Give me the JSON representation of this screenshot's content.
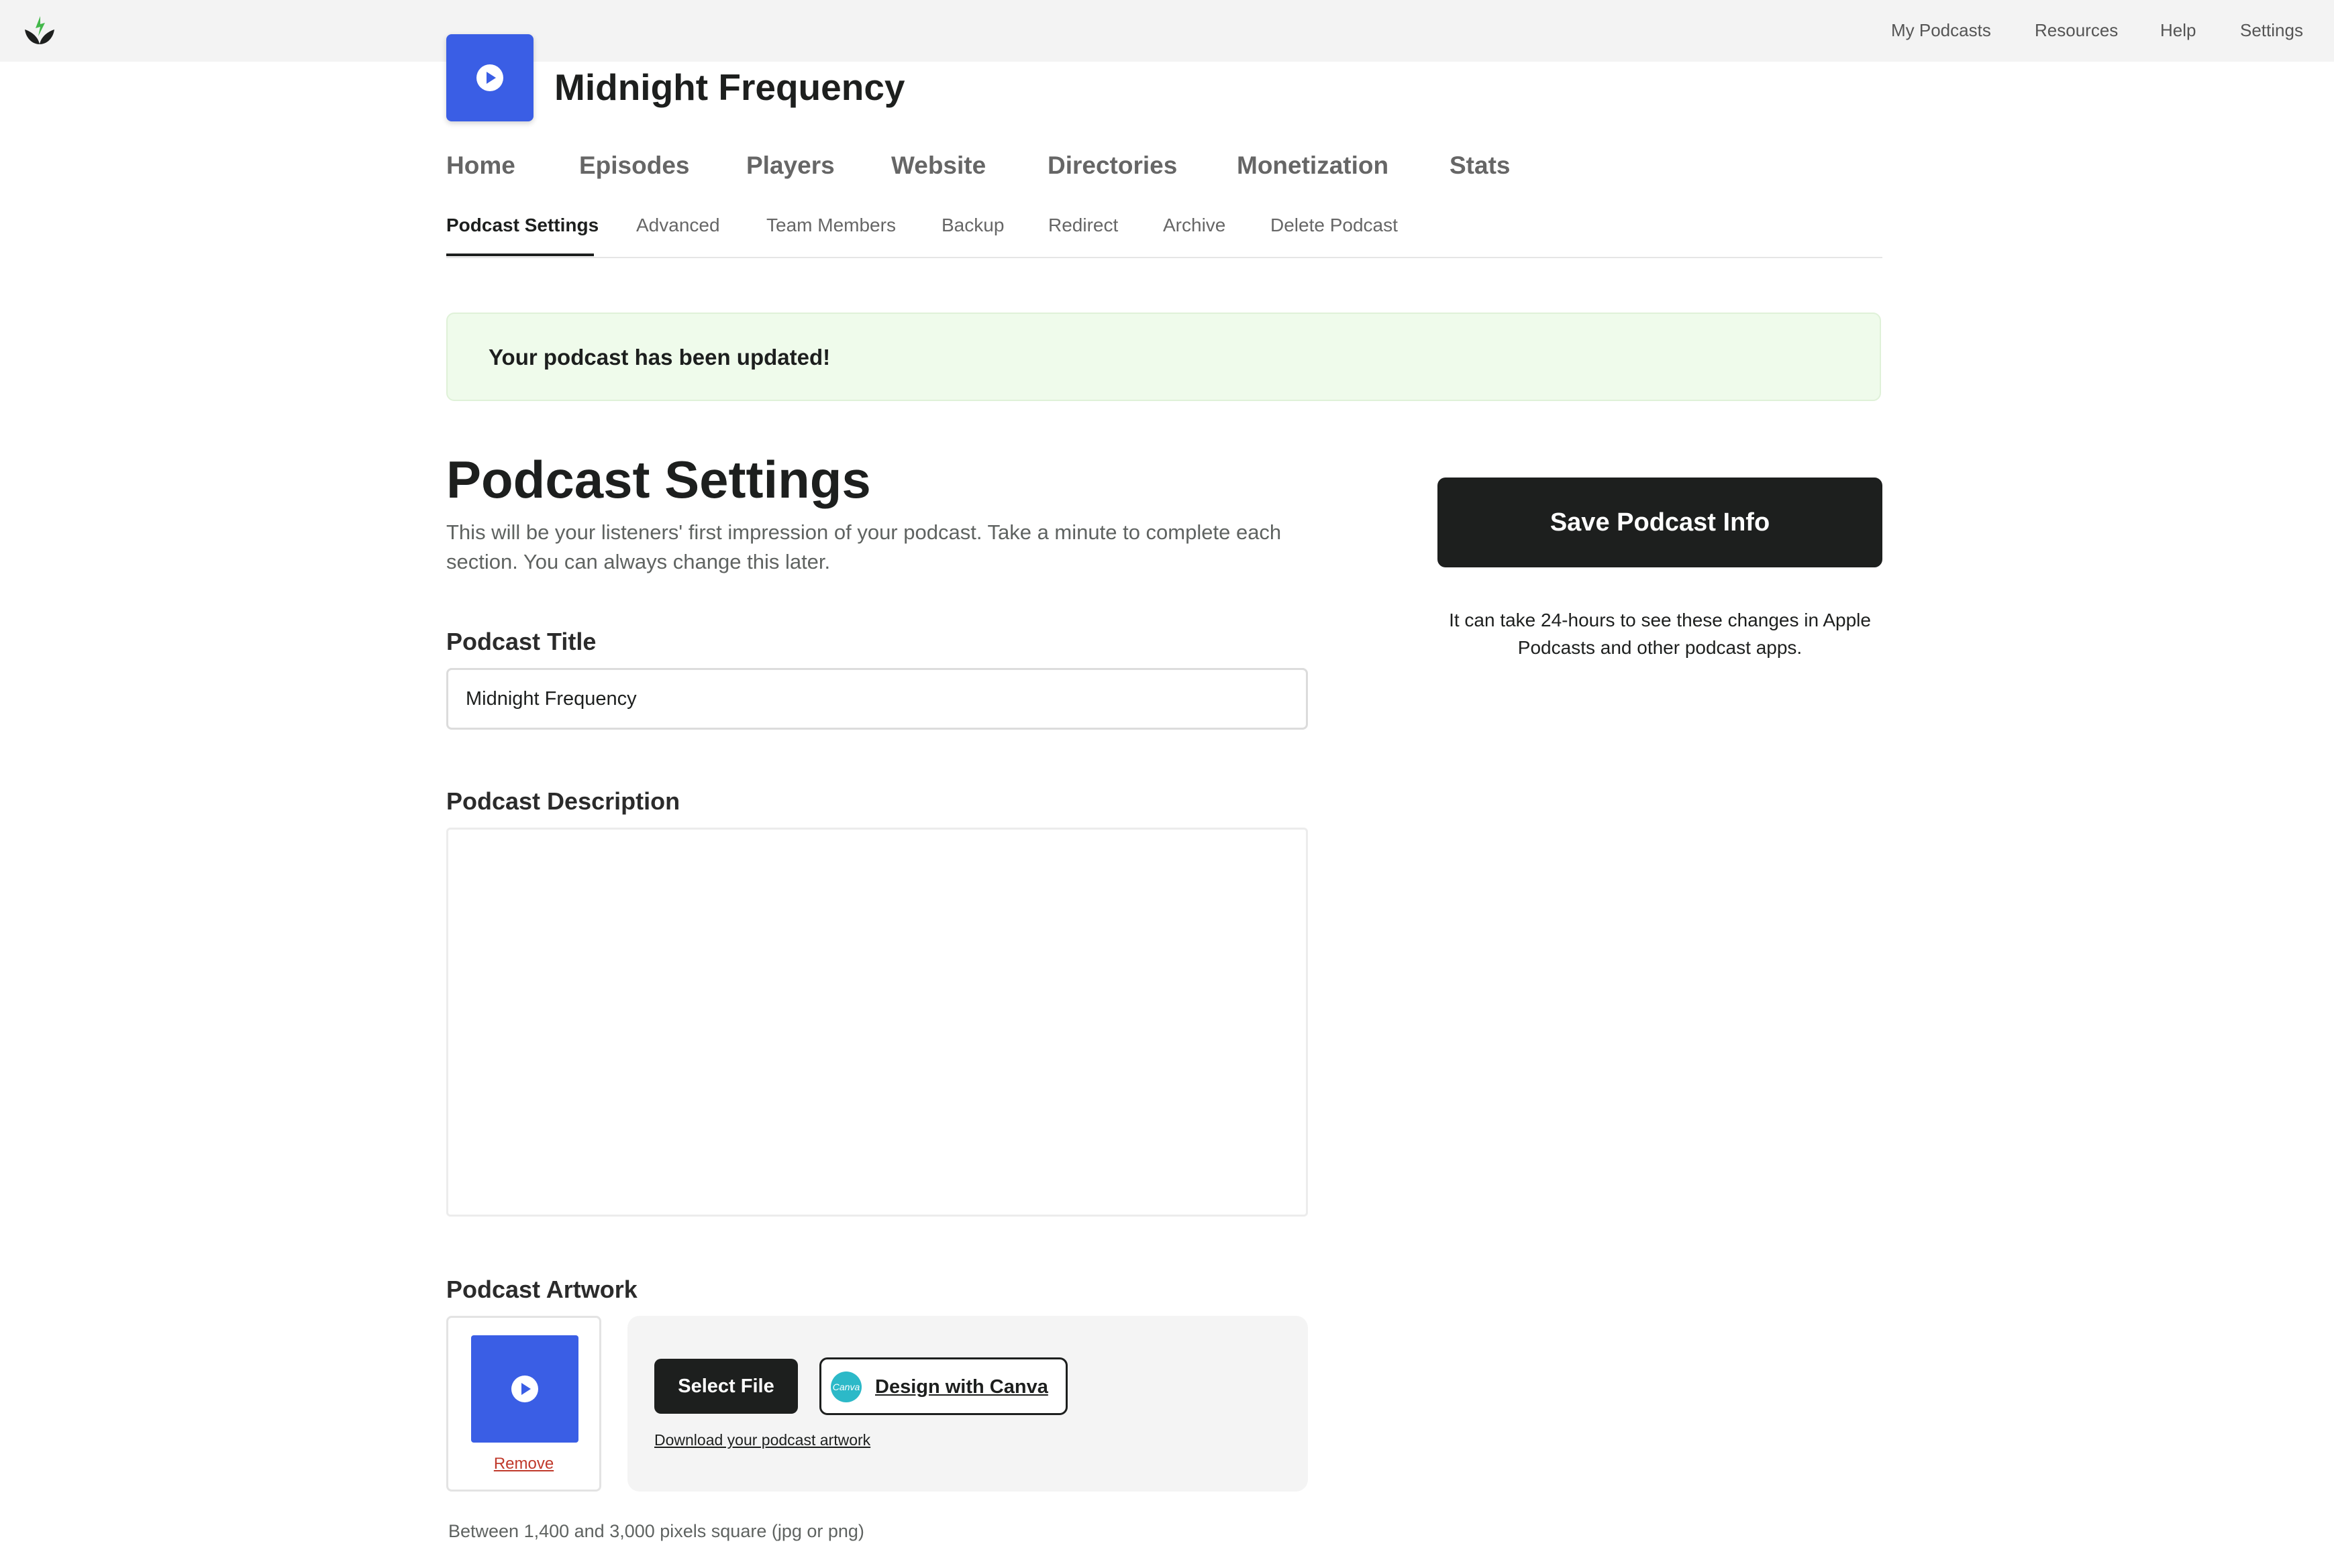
{
  "topbar": {
    "nav": [
      "My Podcasts",
      "Resources",
      "Help",
      "Settings"
    ]
  },
  "podcast": {
    "name": "Midnight Frequency",
    "cover_color": "#3a5ee5"
  },
  "main_tabs": [
    "Home",
    "Episodes",
    "Players",
    "Website",
    "Directories",
    "Monetization",
    "Stats"
  ],
  "sub_tabs": [
    "Podcast Settings",
    "Advanced",
    "Team Members",
    "Backup",
    "Redirect",
    "Archive",
    "Delete Podcast"
  ],
  "active_sub_tab": "Podcast Settings",
  "alert": {
    "message": "Your podcast has been updated!"
  },
  "settings": {
    "title": "Podcast Settings",
    "description": "This will be your listeners' first impression of your podcast. Take a minute to complete each section. You can always change this later.",
    "title_label": "Podcast Title",
    "title_value": "Midnight Frequency",
    "description_label": "Podcast Description",
    "description_value": "",
    "artwork_label": "Podcast Artwork",
    "remove_label": "Remove",
    "select_file_label": "Select File",
    "canva_logo_text": "Canva",
    "canva_label": "Design with Canva",
    "download_label": "Download your podcast artwork",
    "artwork_hint": "Between 1,400 and 3,000 pixels square (jpg or png)"
  },
  "sidebar": {
    "save_label": "Save Podcast Info",
    "note": "It can take 24-hours to see these changes in Apple Podcasts and other podcast apps."
  },
  "colors": {
    "accent_dark": "#1d1f1e",
    "alert_bg": "#effbeb",
    "brand_blue": "#3a5ee5",
    "remove_red": "#c0392b"
  }
}
